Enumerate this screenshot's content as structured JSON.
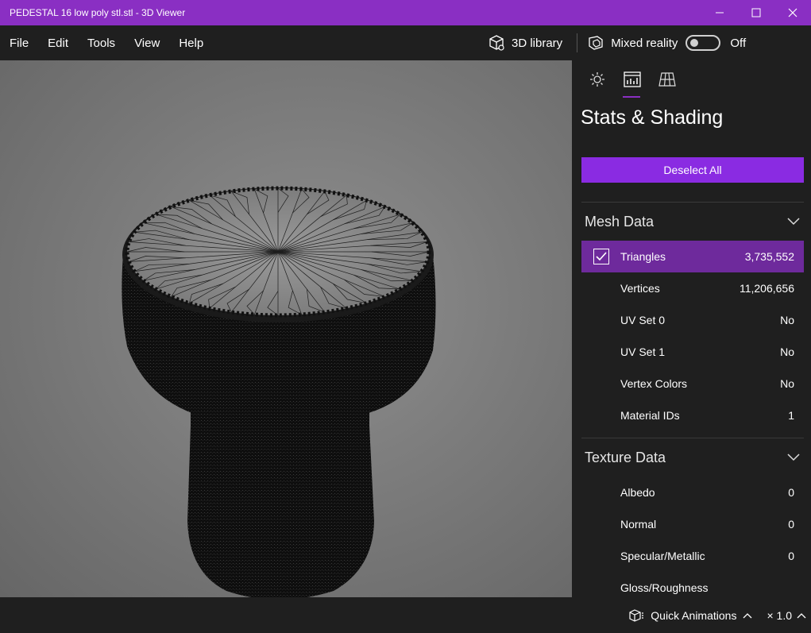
{
  "window": {
    "title": "PEDESTAL 16 low poly stl.stl - 3D Viewer",
    "accent_color": "#8a2fc3"
  },
  "menu": {
    "items": [
      {
        "label": "File"
      },
      {
        "label": "Edit"
      },
      {
        "label": "Tools"
      },
      {
        "label": "View"
      },
      {
        "label": "Help"
      }
    ],
    "library_label": "3D library",
    "mixed_reality_label": "Mixed reality",
    "mixed_reality_state": "Off"
  },
  "panel": {
    "tabs": [
      {
        "icon": "lighting-icon",
        "active": false
      },
      {
        "icon": "stats-icon",
        "active": true
      },
      {
        "icon": "grid-icon",
        "active": false
      }
    ],
    "title": "Stats & Shading",
    "deselect_label": "Deselect All",
    "mesh_section": {
      "title": "Mesh Data",
      "rows": [
        {
          "label": "Triangles",
          "value": "3,735,552",
          "checked": true
        },
        {
          "label": "Vertices",
          "value": "11,206,656"
        },
        {
          "label": "UV Set 0",
          "value": "No"
        },
        {
          "label": "UV Set 1",
          "value": "No"
        },
        {
          "label": "Vertex Colors",
          "value": "No"
        },
        {
          "label": "Material IDs",
          "value": "1"
        }
      ]
    },
    "texture_section": {
      "title": "Texture Data",
      "rows": [
        {
          "label": "Albedo",
          "value": "0"
        },
        {
          "label": "Normal",
          "value": "0"
        },
        {
          "label": "Specular/Metallic",
          "value": "0"
        },
        {
          "label": "Gloss/Roughness",
          "value": ""
        }
      ]
    }
  },
  "status": {
    "quick_animations_label": "Quick Animations",
    "zoom_label": "× 1.0"
  }
}
